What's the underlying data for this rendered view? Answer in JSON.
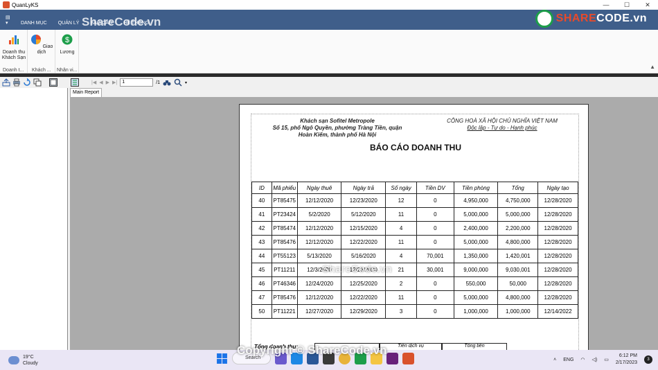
{
  "window": {
    "title": "QuanLyKS",
    "controls": [
      "—",
      "☐",
      "✕"
    ]
  },
  "ribbon": {
    "file_tab": "▤ ▾",
    "tabs": [
      "DANH MỤC",
      "QUẢN LÝ",
      "BÁO CÁO",
      "HỆ THỐNG"
    ],
    "buttons": [
      {
        "label": "Doanh thu Khách Sạn",
        "group": "Doanh t..."
      },
      {
        "label": "Giao dịch",
        "group": "Khách ..."
      },
      {
        "label": "Lương",
        "group": "Nhân vi..."
      }
    ],
    "collapse": "▲"
  },
  "brand": {
    "prefix": "SHARE",
    "suffix": "CODE.vn"
  },
  "viewer": {
    "page_current": "1",
    "page_total": "/1",
    "main_tab": "Main Report"
  },
  "report": {
    "hotel_name": "Khách sạn Sofitel Metropole",
    "hotel_address": "Số 15, phố Ngô Quyền, phường Tràng Tiền, quận Hoàn Kiếm, thành phố Hà Nội",
    "nation": "CÔNG HOÀ XÃ HỘI CHỦ NGHĨA VIỆT NAM",
    "motto": "Độc lập - Tự do - Hạnh phúc",
    "title": "BÁO CÁO DOANH THU",
    "columns": [
      "ID",
      "Mã phiếu",
      "Ngày thuê",
      "Ngày trả",
      "Số ngày",
      "Tiền DV",
      "Tiền phòng",
      "Tổng",
      "Ngày tạo"
    ],
    "rows": [
      [
        "40",
        "PT85475",
        "12/12/2020",
        "12/23/2020",
        "12",
        "0",
        "4,950,000",
        "4,750,000",
        "12/28/2020"
      ],
      [
        "41",
        "PT23424",
        "5/2/2020",
        "5/12/2020",
        "11",
        "0",
        "5,000,000",
        "5,000,000",
        "12/28/2020"
      ],
      [
        "42",
        "PT85474",
        "12/12/2020",
        "12/15/2020",
        "4",
        "0",
        "2,400,000",
        "2,200,000",
        "12/28/2020"
      ],
      [
        "43",
        "PT85476",
        "12/12/2020",
        "12/22/2020",
        "11",
        "0",
        "5,000,000",
        "4,800,000",
        "12/28/2020"
      ],
      [
        "44",
        "PT55123",
        "5/13/2020",
        "5/16/2020",
        "4",
        "70,001",
        "1,350,000",
        "1,420,001",
        "12/28/2020"
      ],
      [
        "45",
        "PT11211",
        "12/3/2020",
        "12/23/2020",
        "21",
        "30,001",
        "9,000,000",
        "9,030,001",
        "12/28/2020"
      ],
      [
        "46",
        "PT46346",
        "12/24/2020",
        "12/25/2020",
        "2",
        "0",
        "550,000",
        "50,000",
        "12/28/2020"
      ],
      [
        "47",
        "PT85476",
        "12/12/2020",
        "12/22/2020",
        "11",
        "0",
        "5,000,000",
        "4,800,000",
        "12/28/2020"
      ],
      [
        "50",
        "PT11221",
        "12/27/2020",
        "12/29/2020",
        "3",
        "0",
        "1,000,000",
        "1,000,000",
        "12/14/2022"
      ]
    ],
    "summary_label": "Tổng doanh thu:",
    "summary_boxes": [
      "",
      "Tiền dịch vụ",
      "Tổng tiền"
    ]
  },
  "watermark": {
    "center": "ShareCode.vn",
    "bottom": "Copyright © ShareCode.vn",
    "top": "ShareCode.vn"
  },
  "taskbar": {
    "temperature": "19°C",
    "condition": "Cloudy",
    "search": "Search",
    "language": "ENG",
    "time": "6:12 PM",
    "date": "2/17/2023",
    "notifications": "3"
  }
}
